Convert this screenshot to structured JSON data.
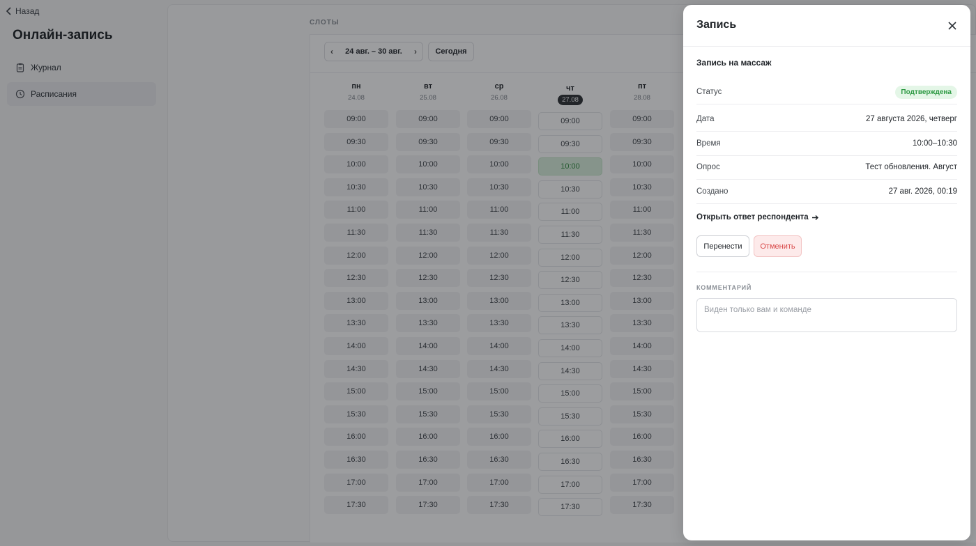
{
  "sidebar": {
    "back_label": "Назад",
    "title": "Онлайн-запись",
    "items": [
      {
        "label": "Журнал",
        "icon": "clipboard-icon"
      },
      {
        "label": "Расписания",
        "icon": "clock-icon"
      }
    ]
  },
  "calendar": {
    "section_label": "СЛОТЫ",
    "week_range": "24 авг. – 30 авг.",
    "today_label": "Сегодня",
    "days": [
      {
        "name": "пн",
        "date": "24.08"
      },
      {
        "name": "вт",
        "date": "25.08"
      },
      {
        "name": "ср",
        "date": "26.08"
      },
      {
        "name": "чт",
        "date": "27.08"
      },
      {
        "name": "пт",
        "date": "28.08"
      }
    ],
    "slots": [
      "09:00",
      "09:30",
      "10:00",
      "10:30",
      "11:00",
      "11:30",
      "12:00",
      "12:30",
      "13:00",
      "13:30",
      "14:00",
      "14:30",
      "15:00",
      "15:30",
      "16:00",
      "16:30",
      "17:00",
      "17:30"
    ],
    "booked": {
      "day": "чт",
      "time": "10:00"
    }
  },
  "drawer": {
    "title": "Запись",
    "booking_name": "Запись на массаж",
    "status_label": "Статус",
    "status_value": "Подтверждена",
    "date_label": "Дата",
    "date_value": "27 августа 2026, четверг",
    "time_label": "Время",
    "time_value": "10:00–10:30",
    "survey_label": "Опрос",
    "survey_value": "Тест обновления. Август",
    "created_label": "Создано",
    "created_value": "27 авг. 2026, 00:19",
    "open_response": "Открыть ответ респондента",
    "move_button": "Перенести",
    "cancel_button": "Отменить",
    "comment_label": "КОММЕНТАРИЙ",
    "comment_placeholder": "Виден только вам и команде",
    "colors": {
      "status_bg": "#e4f6e7",
      "status_text": "#2e9a44",
      "cancel_text": "#d94848"
    }
  }
}
